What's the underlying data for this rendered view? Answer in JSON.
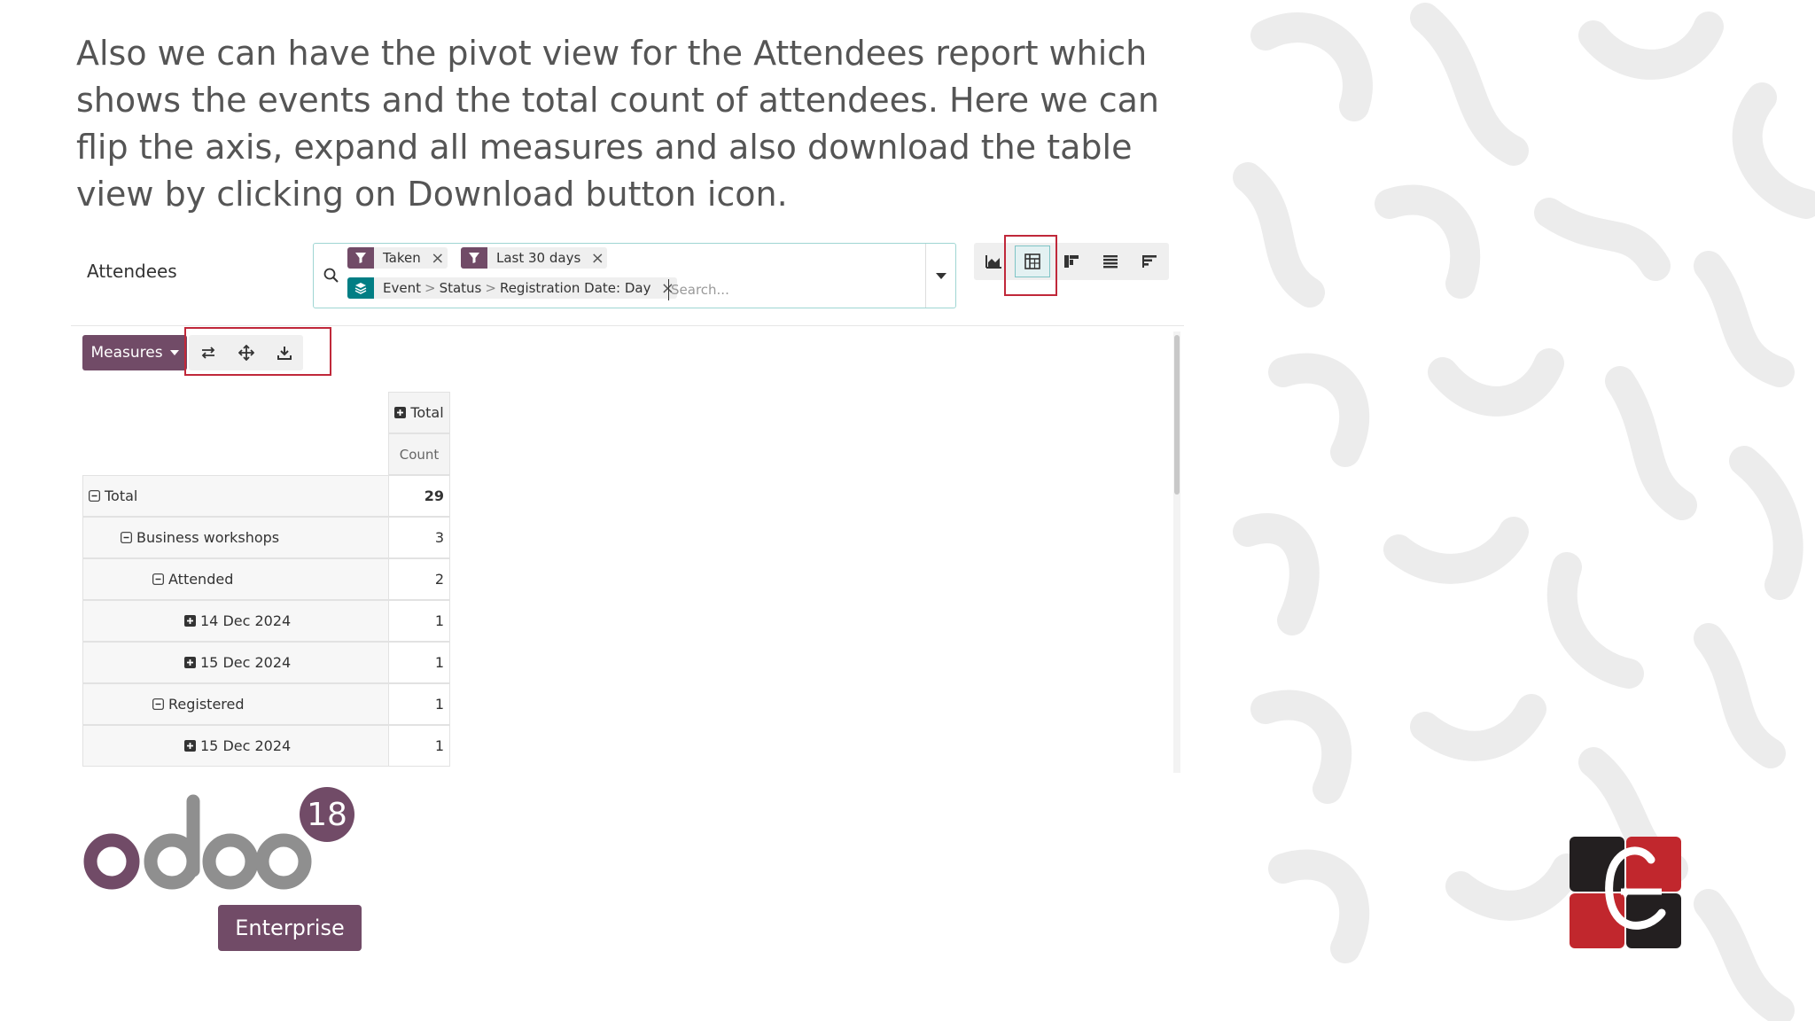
{
  "caption": "Also we can have the pivot view for the Attendees report which shows the events and the total count of attendees. Here we can flip the axis, expand all measures and also download the table view by clicking on Download button icon.",
  "control_panel": {
    "title": "Attendees",
    "facets": {
      "taken": "Taken",
      "last30": "Last 30 days",
      "group_event": "Event",
      "group_status": "Status",
      "group_date": "Registration Date: Day",
      "separator": ">"
    },
    "search_placeholder": "Search...",
    "views": [
      "area-chart-icon",
      "pivot-icon",
      "kanban-icon",
      "list-icon",
      "bars-icon"
    ],
    "active_view": "pivot"
  },
  "toolbar": {
    "measures_label": "Measures",
    "tools": [
      "flip-axis-icon",
      "expand-all-icon",
      "download-icon"
    ]
  },
  "pivot": {
    "col_header": "Total",
    "measure": "Count",
    "rows": [
      {
        "label": "Total",
        "value": "29",
        "level": 0,
        "state": "expanded"
      },
      {
        "label": "Business workshops",
        "value": "3",
        "level": 1,
        "state": "expanded"
      },
      {
        "label": "Attended",
        "value": "2",
        "level": 2,
        "state": "expanded"
      },
      {
        "label": "14 Dec 2024",
        "value": "1",
        "level": 3,
        "state": "collapsed"
      },
      {
        "label": "15 Dec 2024",
        "value": "1",
        "level": 3,
        "state": "collapsed"
      },
      {
        "label": "Registered",
        "value": "1",
        "level": 2,
        "state": "expanded"
      },
      {
        "label": "15 Dec 2024",
        "value": "1",
        "level": 3,
        "state": "collapsed"
      }
    ]
  },
  "branding": {
    "version": "18",
    "edition": "Enterprise",
    "brand_color": "#714b67",
    "accent_teal": "#017e84",
    "highlight_color": "#c0283a"
  }
}
